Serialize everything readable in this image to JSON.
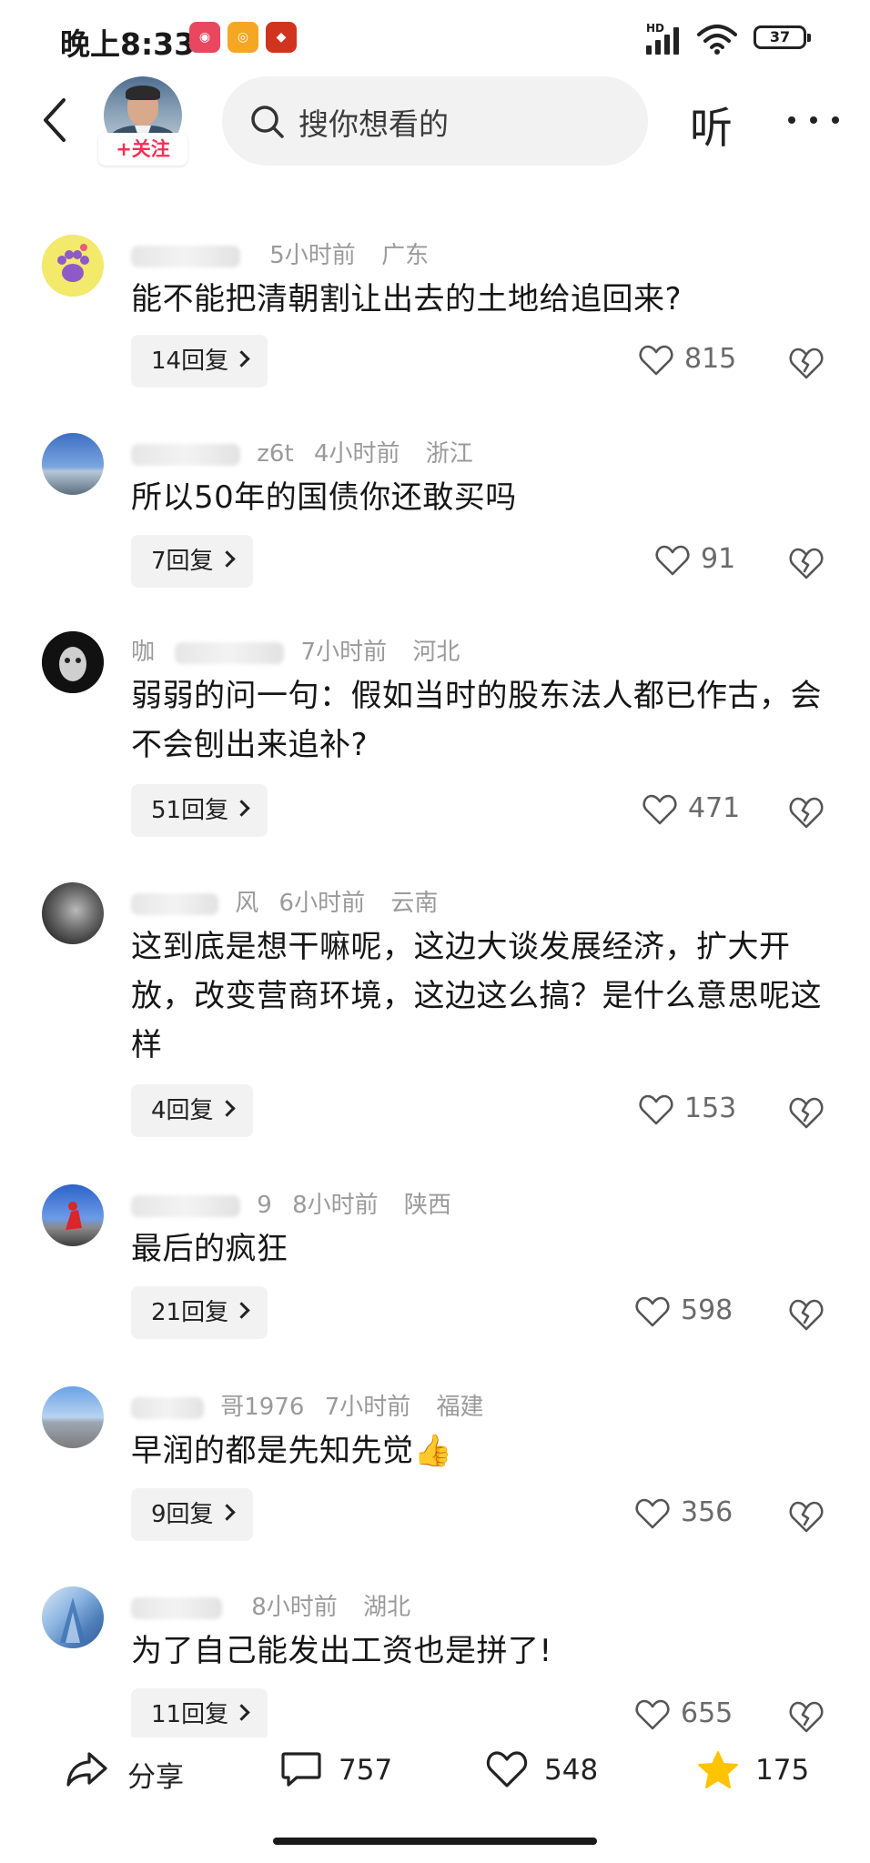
{
  "status_bar": {
    "time": "晚上8:33",
    "network": "HD",
    "battery": "37"
  },
  "header": {
    "follow_label": "+关注",
    "search_placeholder": "搜你想看的",
    "listen_label": "听"
  },
  "comments": [
    {
      "name": "",
      "time": "5小时前",
      "location": "广东",
      "text": "能不能把清朝割让出去的土地给追回来?",
      "replies": "14回复",
      "likes": "815"
    },
    {
      "name": "z6t",
      "time": "4小时前",
      "location": "浙江",
      "text": "所以50年的国债你还敢买吗",
      "replies": "7回复",
      "likes": "91"
    },
    {
      "name": "咖",
      "time": "7小时前",
      "location": "河北",
      "text": "弱弱的问一句：假如当时的股东法人都已作古，会不会刨出来追补?",
      "replies": "51回复",
      "likes": "471"
    },
    {
      "name": "风",
      "time": "6小时前",
      "location": "云南",
      "text": "这到底是想干嘛呢，这边大谈发展经济，扩大开放，改变营商环境，这边这么搞？是什么意思呢这样",
      "replies": "4回复",
      "likes": "153"
    },
    {
      "name": "9",
      "time": "8小时前",
      "location": "陕西",
      "text": "最后的疯狂",
      "replies": "21回复",
      "likes": "598"
    },
    {
      "name": "哥1976",
      "time": "7小时前",
      "location": "福建",
      "text": "早润的都是先知先觉👍",
      "replies": "9回复",
      "likes": "356"
    },
    {
      "name": "",
      "time": "8小时前",
      "location": "湖北",
      "text": "为了自己能发出工资也是拼了!",
      "replies": "11回复",
      "likes": "655"
    }
  ],
  "bottom_bar": {
    "share_label": "分享",
    "comment_count": "757",
    "like_count": "548",
    "favorite_count": "175"
  },
  "colors": {
    "accent": "#fe2c55",
    "favorite": "#ffc300",
    "text": "#161616",
    "meta": "#9a9a9a",
    "chip_bg": "#f2f2f3"
  }
}
